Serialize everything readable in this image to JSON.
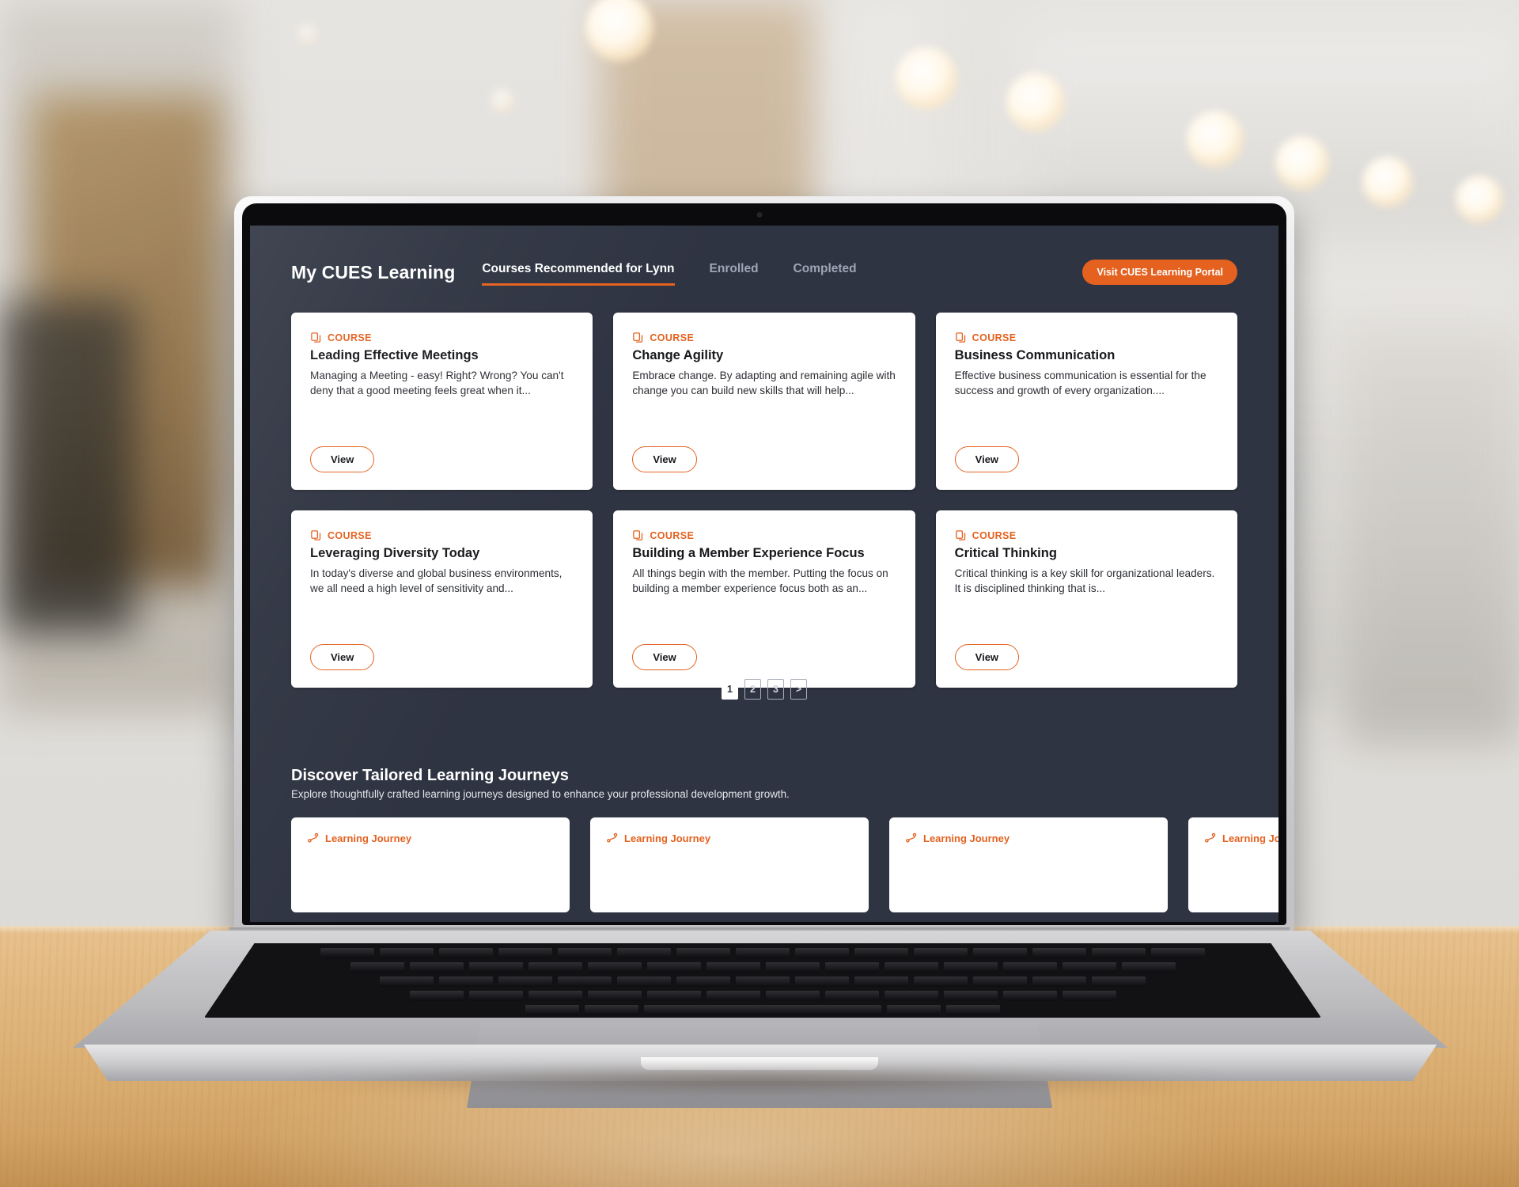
{
  "header": {
    "brand": "My CUES Learning",
    "tabs": [
      {
        "label": "Courses Recommended for Lynn",
        "active": true
      },
      {
        "label": "Enrolled",
        "active": false
      },
      {
        "label": "Completed",
        "active": false
      }
    ],
    "portal_button": "Visit CUES Learning Portal"
  },
  "colors": {
    "accent_orange": "#e4611f",
    "screen_background": "#2f3442",
    "card_background": "#ffffff",
    "card_title": "#17181c",
    "tab_inactive": "#9fa5b4"
  },
  "courses": {
    "kicker": "COURSE",
    "view_label": "View",
    "icon": "copy-pages-icon",
    "items": [
      {
        "title": "Leading Effective Meetings",
        "description": "Managing a Meeting - easy! Right? Wrong? You can't deny that a good meeting feels great when it..."
      },
      {
        "title": "Change Agility",
        "description": "Embrace change. By adapting and remaining agile with change you can build new skills that will help..."
      },
      {
        "title": "Business Communication",
        "description": "Effective business communication is essential for the success and growth of every organization...."
      },
      {
        "title": "Leveraging Diversity Today",
        "description": "In today's diverse and global business environments, we all need a high level of sensitivity and..."
      },
      {
        "title": "Building a Member Experience Focus",
        "description": "All things begin with the member. Putting the focus on building a member experience focus both as an..."
      },
      {
        "title": "Critical Thinking",
        "description": "Critical thinking is a key skill for organizational leaders. It is disciplined thinking that is..."
      }
    ]
  },
  "pagination": {
    "pages": [
      {
        "label": "1",
        "active": true
      },
      {
        "label": "2",
        "active": false
      },
      {
        "label": "3",
        "active": false
      },
      {
        "label": ">",
        "active": false
      }
    ]
  },
  "journeys": {
    "title": "Discover Tailored Learning Journeys",
    "subtitle": "Explore thoughtfully crafted learning journeys designed to enhance your professional development growth.",
    "kicker": "Learning Journey",
    "icon": "route-path-icon",
    "cards": [
      {
        "kicker": "Learning Journey"
      },
      {
        "kicker": "Learning Journey"
      },
      {
        "kicker": "Learning Journey"
      },
      {
        "kicker": "Learning Journey"
      }
    ]
  }
}
